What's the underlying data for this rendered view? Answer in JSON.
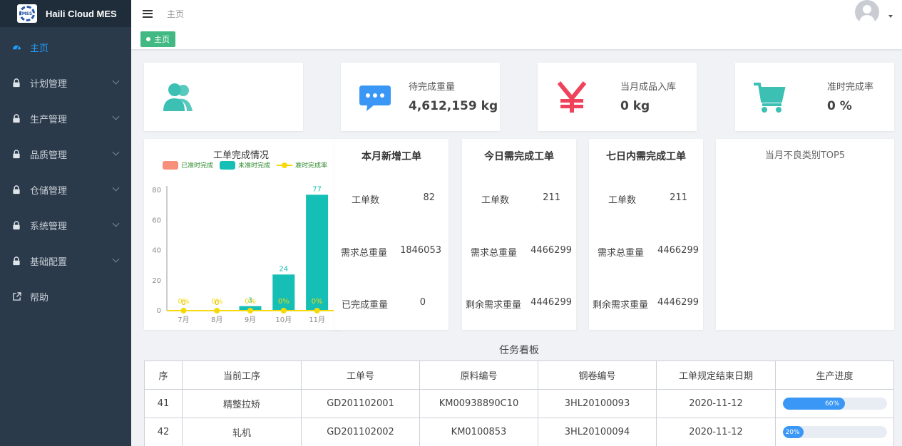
{
  "app": {
    "name": "Haili Cloud MES",
    "logo_text": "MES"
  },
  "sidebar": {
    "items": [
      {
        "label": "主页",
        "icon": "dashboard-icon",
        "active": true,
        "expandable": false
      },
      {
        "label": "计划管理",
        "icon": "lock-icon",
        "active": false,
        "expandable": true
      },
      {
        "label": "生产管理",
        "icon": "lock-icon",
        "active": false,
        "expandable": true
      },
      {
        "label": "品质管理",
        "icon": "lock-icon",
        "active": false,
        "expandable": true
      },
      {
        "label": "仓储管理",
        "icon": "lock-icon",
        "active": false,
        "expandable": true
      },
      {
        "label": "系统管理",
        "icon": "lock-icon",
        "active": false,
        "expandable": true
      },
      {
        "label": "基础配置",
        "icon": "lock-icon",
        "active": false,
        "expandable": true
      },
      {
        "label": "帮助",
        "icon": "external-link-icon",
        "active": false,
        "expandable": false
      }
    ]
  },
  "header": {
    "breadcrumb": "主页",
    "tab_label": "主页"
  },
  "stats": [
    {
      "icon": "users-icon",
      "label": "",
      "value": "",
      "color": "#3cc0b4"
    },
    {
      "icon": "chat-bubble-icon",
      "label": "待完成重量",
      "value": "4,612,159 kg",
      "color": "#3a97f5"
    },
    {
      "icon": "yen-icon",
      "label": "当月成品入库",
      "value": "0 kg",
      "color": "#f0435b"
    },
    {
      "icon": "cart-icon",
      "label": "准时完成率",
      "value": "0 %",
      "color": "#3cc0b4"
    }
  ],
  "chart_data": {
    "type": "bar",
    "title": "工单完成情况",
    "categories": [
      "7月",
      "8月",
      "9月",
      "10月",
      "11月"
    ],
    "series": [
      {
        "name": "已准时完成",
        "type": "bar",
        "color": "#f7907a",
        "values": [
          0,
          0,
          0,
          0,
          0
        ]
      },
      {
        "name": "未准时完成",
        "type": "bar",
        "color": "#15bfb5",
        "values": [
          0,
          0,
          3,
          24,
          77
        ]
      },
      {
        "name": "准时完成率",
        "type": "line",
        "color": "#f5d90a",
        "values": [
          "0%",
          "0%",
          "0%",
          "0%",
          "0%"
        ]
      }
    ],
    "ylim": [
      0,
      80
    ],
    "yticks": [
      0,
      20,
      40,
      60,
      80
    ],
    "legend_position": "top"
  },
  "work_orders": [
    {
      "title": "本月新增工单",
      "rows": [
        {
          "label": "工单数",
          "value": "82"
        },
        {
          "label": "需求总重量",
          "value": "1846053"
        },
        {
          "label": "已完成重量",
          "value": "0"
        }
      ]
    },
    {
      "title": "今日需完成工单",
      "rows": [
        {
          "label": "工单数",
          "value": "211"
        },
        {
          "label": "需求总重量",
          "value": "4466299"
        },
        {
          "label": "剩余需求重量",
          "value": "4446299"
        }
      ]
    },
    {
      "title": "七日内需完成工单",
      "rows": [
        {
          "label": "工单数",
          "value": "211"
        },
        {
          "label": "需求总重量",
          "value": "4466299"
        },
        {
          "label": "剩余需求重量",
          "value": "4446299"
        }
      ]
    }
  ],
  "defect": {
    "title": "当月不良类别TOP5"
  },
  "board": {
    "title": "任务看板",
    "columns": [
      "序",
      "当前工序",
      "工单号",
      "原料编号",
      "钢卷编号",
      "工单规定结束日期",
      "生产进度"
    ],
    "rows": [
      {
        "seq": "41",
        "process": "精整拉矫",
        "order_no": "GD201102001",
        "material_no": "KM00938890C10",
        "coil_no": "3HL20100093",
        "end_date": "2020-11-12",
        "progress": 60,
        "progress_label": "60%"
      },
      {
        "seq": "42",
        "process": "轧机",
        "order_no": "GD201102002",
        "material_no": "KM0100853",
        "coil_no": "3HL20100094",
        "end_date": "2020-11-12",
        "progress": 20,
        "progress_label": "20%"
      }
    ]
  }
}
